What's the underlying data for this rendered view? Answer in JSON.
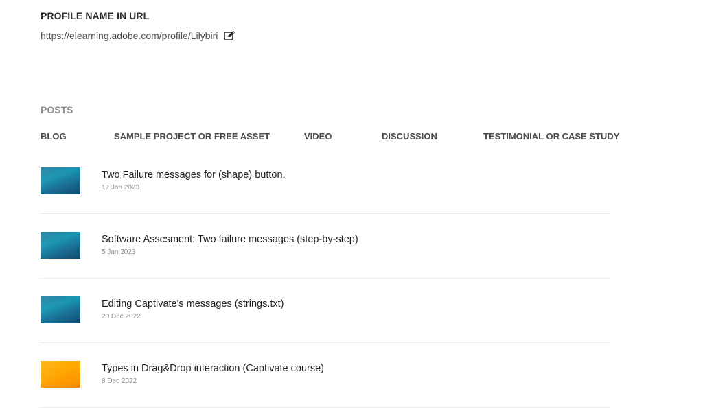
{
  "profile": {
    "section_title": "PROFILE NAME IN URL",
    "url": "https://elearning.adobe.com/profile/Lilybiri",
    "edit_icon": "edit-pencil-icon"
  },
  "posts": {
    "section_title": "POSTS",
    "tabs": [
      {
        "label": "BLOG"
      },
      {
        "label": "SAMPLE PROJECT OR FREE ASSET"
      },
      {
        "label": "VIDEO"
      },
      {
        "label": "DISCUSSION"
      },
      {
        "label": "TESTIMONIAL OR CASE STUDY"
      }
    ],
    "items": [
      {
        "title": "Two Failure messages for (shape) button.",
        "date": "17 Jan 2023",
        "thumb_color": "#1b96b3"
      },
      {
        "title": "Software Assesment: Two failure messages (step-by-step)",
        "date": "5 Jan 2023",
        "thumb_color": "#1b96b3"
      },
      {
        "title": "Editing Captivate's messages (strings.txt)",
        "date": "20 Dec 2022",
        "thumb_color": "#1b96b3"
      },
      {
        "title": "Types in Drag&Drop interaction (Captivate course)",
        "date": "8 Dec 2022",
        "thumb_color": "#ffa900"
      }
    ]
  }
}
